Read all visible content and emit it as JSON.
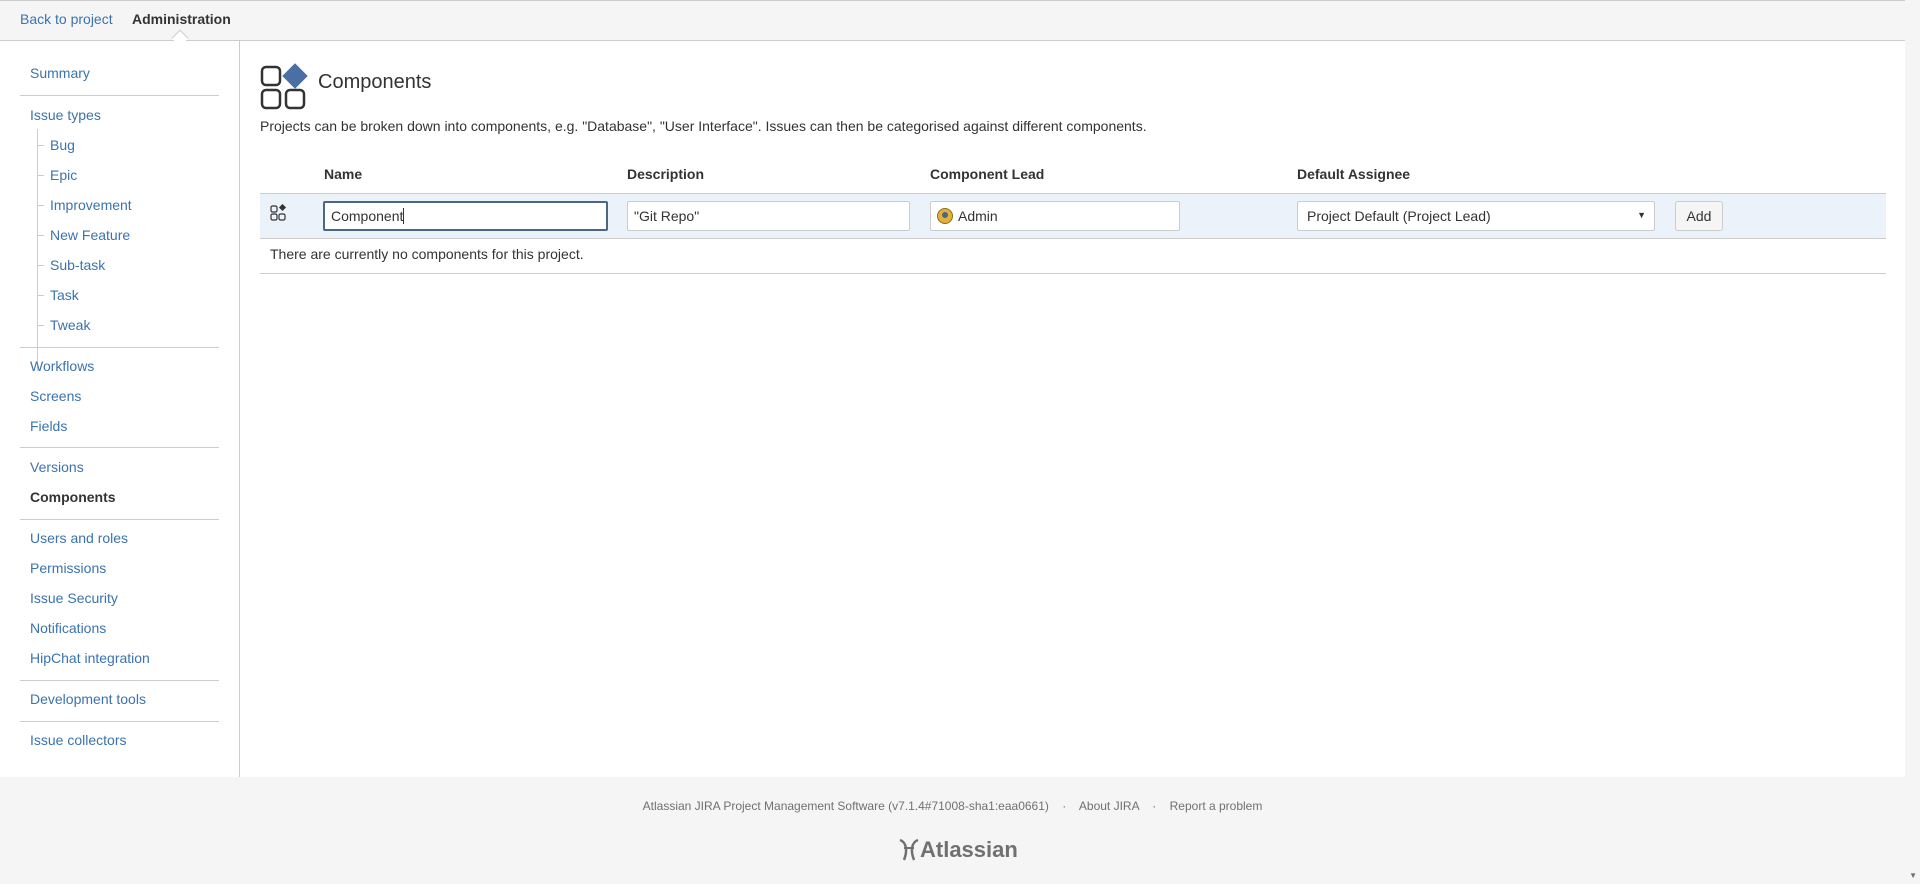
{
  "topbar": {
    "back_label": "Back to project",
    "admin_label": "Administration"
  },
  "sidebar": {
    "summary": "Summary",
    "issue_types": "Issue types",
    "issue_type_items": [
      "Bug",
      "Epic",
      "Improvement",
      "New Feature",
      "Sub-task",
      "Task",
      "Tweak"
    ],
    "workflows": "Workflows",
    "screens": "Screens",
    "fields": "Fields",
    "versions": "Versions",
    "components": "Components",
    "users_roles": "Users and roles",
    "permissions": "Permissions",
    "issue_security": "Issue Security",
    "notifications": "Notifications",
    "hipchat": "HipChat integration",
    "dev_tools": "Development tools",
    "issue_collectors": "Issue collectors"
  },
  "main": {
    "title": "Components",
    "description": "Projects can be broken down into components, e.g. \"Database\", \"User Interface\". Issues can then be categorised against different components.",
    "columns": {
      "name": "Name",
      "description": "Description",
      "lead": "Component Lead",
      "assignee": "Default Assignee"
    },
    "form": {
      "name_value": "Component",
      "description_value": "\"Git Repo\"",
      "lead_value": "Admin",
      "assignee_value": "Project Default (Project Lead)",
      "add_label": "Add"
    },
    "empty_message": "There are currently no components for this project."
  },
  "footer": {
    "version_text": "Atlassian JIRA Project Management Software (v7.1.4#71008-sha1:eaa0661)",
    "about": "About JIRA",
    "report": "Report a problem",
    "logo_text": "Atlassian"
  },
  "colors": {
    "link": "#3b73af",
    "row_highlight": "#ebf2f9",
    "icon_accent": "#4a6fa5"
  }
}
